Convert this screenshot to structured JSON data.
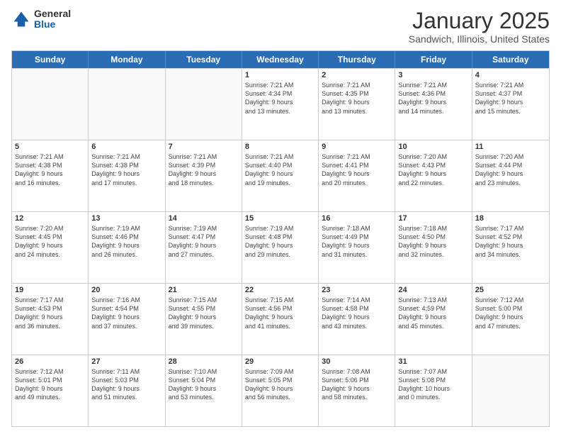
{
  "logo": {
    "general": "General",
    "blue": "Blue"
  },
  "header": {
    "month": "January 2025",
    "location": "Sandwich, Illinois, United States"
  },
  "days": [
    "Sunday",
    "Monday",
    "Tuesday",
    "Wednesday",
    "Thursday",
    "Friday",
    "Saturday"
  ],
  "rows": [
    [
      {
        "day": "",
        "text": ""
      },
      {
        "day": "",
        "text": ""
      },
      {
        "day": "",
        "text": ""
      },
      {
        "day": "1",
        "text": "Sunrise: 7:21 AM\nSunset: 4:34 PM\nDaylight: 9 hours\nand 13 minutes."
      },
      {
        "day": "2",
        "text": "Sunrise: 7:21 AM\nSunset: 4:35 PM\nDaylight: 9 hours\nand 13 minutes."
      },
      {
        "day": "3",
        "text": "Sunrise: 7:21 AM\nSunset: 4:36 PM\nDaylight: 9 hours\nand 14 minutes."
      },
      {
        "day": "4",
        "text": "Sunrise: 7:21 AM\nSunset: 4:37 PM\nDaylight: 9 hours\nand 15 minutes."
      }
    ],
    [
      {
        "day": "5",
        "text": "Sunrise: 7:21 AM\nSunset: 4:38 PM\nDaylight: 9 hours\nand 16 minutes."
      },
      {
        "day": "6",
        "text": "Sunrise: 7:21 AM\nSunset: 4:38 PM\nDaylight: 9 hours\nand 17 minutes."
      },
      {
        "day": "7",
        "text": "Sunrise: 7:21 AM\nSunset: 4:39 PM\nDaylight: 9 hours\nand 18 minutes."
      },
      {
        "day": "8",
        "text": "Sunrise: 7:21 AM\nSunset: 4:40 PM\nDaylight: 9 hours\nand 19 minutes."
      },
      {
        "day": "9",
        "text": "Sunrise: 7:21 AM\nSunset: 4:41 PM\nDaylight: 9 hours\nand 20 minutes."
      },
      {
        "day": "10",
        "text": "Sunrise: 7:20 AM\nSunset: 4:43 PM\nDaylight: 9 hours\nand 22 minutes."
      },
      {
        "day": "11",
        "text": "Sunrise: 7:20 AM\nSunset: 4:44 PM\nDaylight: 9 hours\nand 23 minutes."
      }
    ],
    [
      {
        "day": "12",
        "text": "Sunrise: 7:20 AM\nSunset: 4:45 PM\nDaylight: 9 hours\nand 24 minutes."
      },
      {
        "day": "13",
        "text": "Sunrise: 7:19 AM\nSunset: 4:46 PM\nDaylight: 9 hours\nand 26 minutes."
      },
      {
        "day": "14",
        "text": "Sunrise: 7:19 AM\nSunset: 4:47 PM\nDaylight: 9 hours\nand 27 minutes."
      },
      {
        "day": "15",
        "text": "Sunrise: 7:19 AM\nSunset: 4:48 PM\nDaylight: 9 hours\nand 29 minutes."
      },
      {
        "day": "16",
        "text": "Sunrise: 7:18 AM\nSunset: 4:49 PM\nDaylight: 9 hours\nand 31 minutes."
      },
      {
        "day": "17",
        "text": "Sunrise: 7:18 AM\nSunset: 4:50 PM\nDaylight: 9 hours\nand 32 minutes."
      },
      {
        "day": "18",
        "text": "Sunrise: 7:17 AM\nSunset: 4:52 PM\nDaylight: 9 hours\nand 34 minutes."
      }
    ],
    [
      {
        "day": "19",
        "text": "Sunrise: 7:17 AM\nSunset: 4:53 PM\nDaylight: 9 hours\nand 36 minutes."
      },
      {
        "day": "20",
        "text": "Sunrise: 7:16 AM\nSunset: 4:54 PM\nDaylight: 9 hours\nand 37 minutes."
      },
      {
        "day": "21",
        "text": "Sunrise: 7:15 AM\nSunset: 4:55 PM\nDaylight: 9 hours\nand 39 minutes."
      },
      {
        "day": "22",
        "text": "Sunrise: 7:15 AM\nSunset: 4:56 PM\nDaylight: 9 hours\nand 41 minutes."
      },
      {
        "day": "23",
        "text": "Sunrise: 7:14 AM\nSunset: 4:58 PM\nDaylight: 9 hours\nand 43 minutes."
      },
      {
        "day": "24",
        "text": "Sunrise: 7:13 AM\nSunset: 4:59 PM\nDaylight: 9 hours\nand 45 minutes."
      },
      {
        "day": "25",
        "text": "Sunrise: 7:12 AM\nSunset: 5:00 PM\nDaylight: 9 hours\nand 47 minutes."
      }
    ],
    [
      {
        "day": "26",
        "text": "Sunrise: 7:12 AM\nSunset: 5:01 PM\nDaylight: 9 hours\nand 49 minutes."
      },
      {
        "day": "27",
        "text": "Sunrise: 7:11 AM\nSunset: 5:03 PM\nDaylight: 9 hours\nand 51 minutes."
      },
      {
        "day": "28",
        "text": "Sunrise: 7:10 AM\nSunset: 5:04 PM\nDaylight: 9 hours\nand 53 minutes."
      },
      {
        "day": "29",
        "text": "Sunrise: 7:09 AM\nSunset: 5:05 PM\nDaylight: 9 hours\nand 56 minutes."
      },
      {
        "day": "30",
        "text": "Sunrise: 7:08 AM\nSunset: 5:06 PM\nDaylight: 9 hours\nand 58 minutes."
      },
      {
        "day": "31",
        "text": "Sunrise: 7:07 AM\nSunset: 5:08 PM\nDaylight: 10 hours\nand 0 minutes."
      },
      {
        "day": "",
        "text": ""
      }
    ]
  ]
}
